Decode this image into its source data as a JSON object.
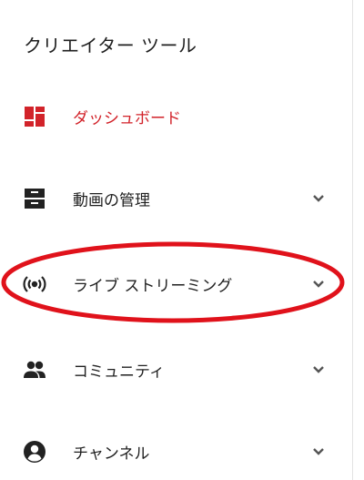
{
  "sidebar": {
    "title": "クリエイター ツール",
    "accent_color": "#d2232a",
    "items": [
      {
        "label": "ダッシュボード",
        "icon": "dashboard-icon",
        "active": true,
        "expandable": false
      },
      {
        "label": "動画の管理",
        "icon": "video-manager-icon",
        "active": false,
        "expandable": true
      },
      {
        "label": "ライブ ストリーミング",
        "icon": "live-streaming-icon",
        "active": false,
        "expandable": true
      },
      {
        "label": "コミュニティ",
        "icon": "people-icon",
        "active": false,
        "expandable": true
      },
      {
        "label": "チャンネル",
        "icon": "account-circle-icon",
        "active": false,
        "expandable": true
      }
    ]
  },
  "annotation": {
    "type": "red-ellipse",
    "target": "live-streaming",
    "color": "#e0121b"
  }
}
